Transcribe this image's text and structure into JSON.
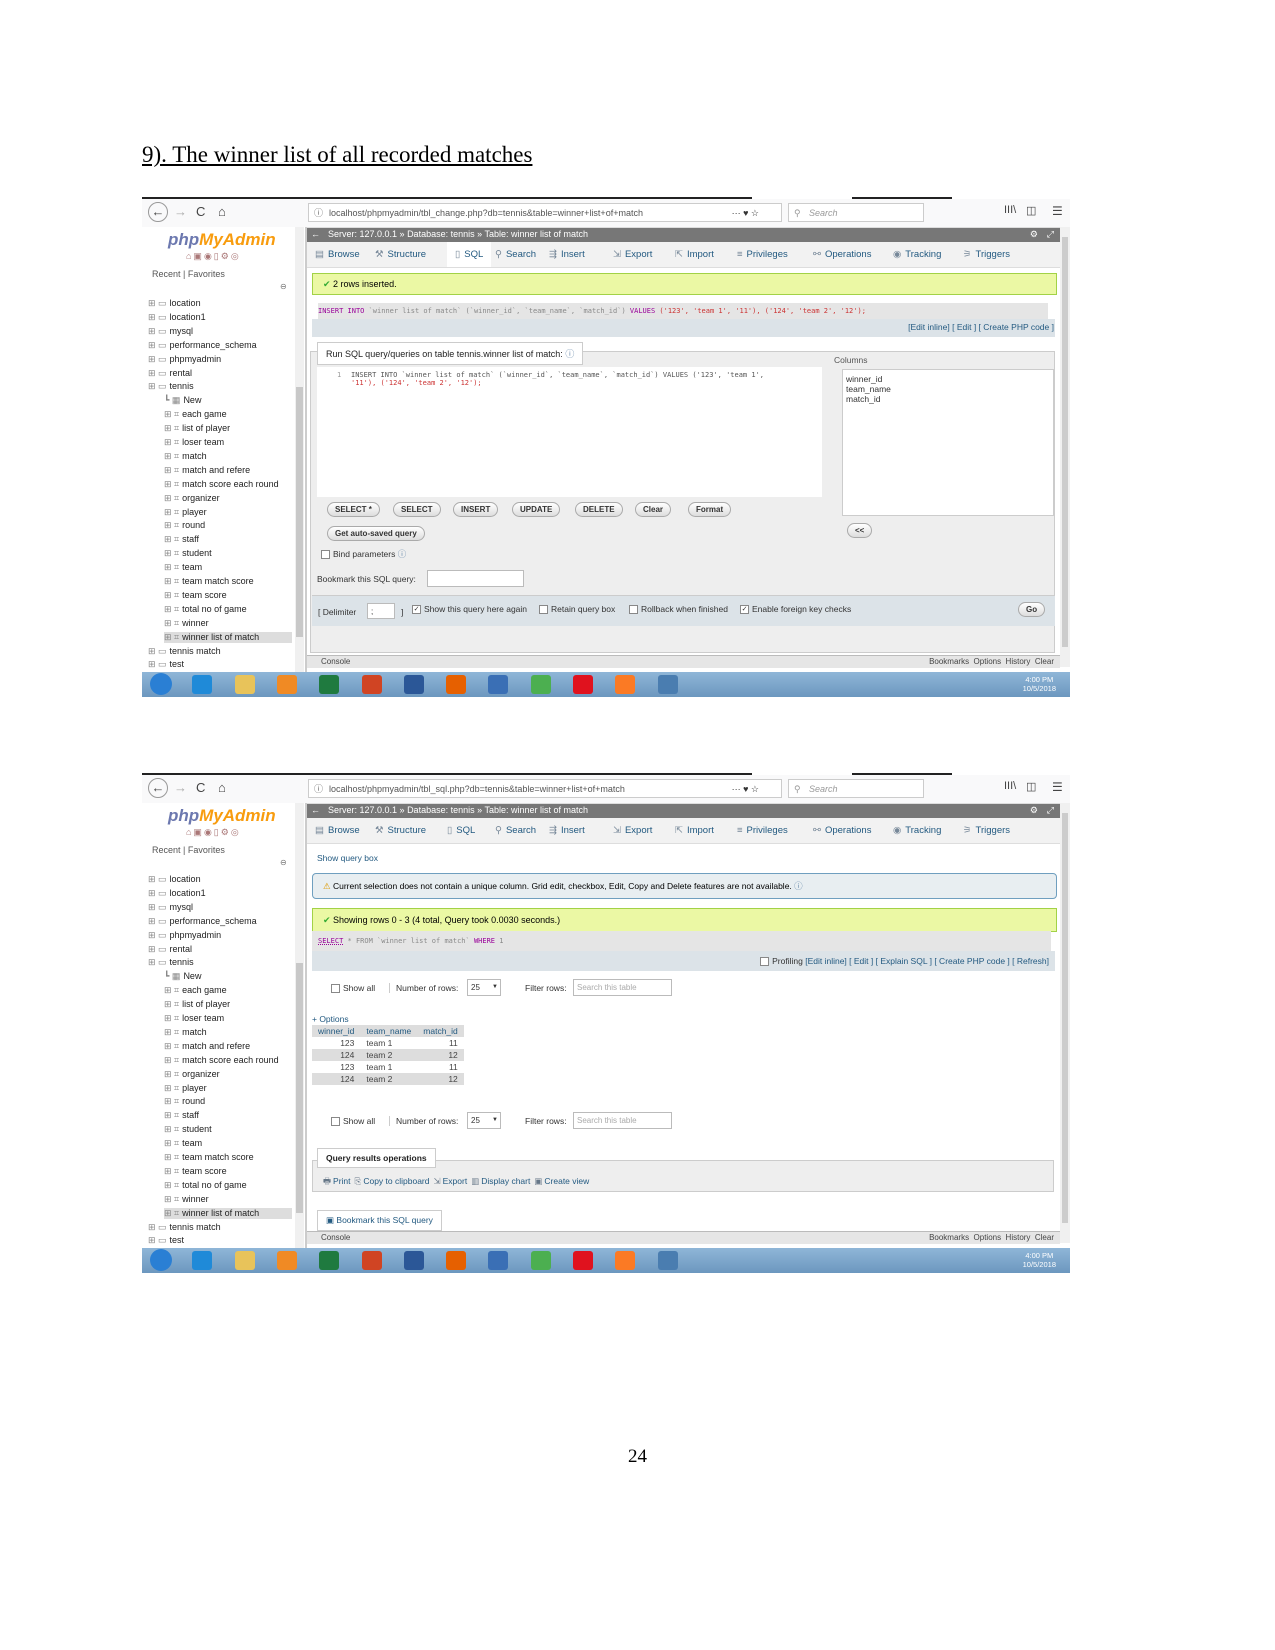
{
  "heading": "9). The winner list of all recorded matches",
  "page_number": "24",
  "browser": {
    "search_placeholder": "Search",
    "back": "←",
    "forward": "→",
    "reload": "C",
    "home": "⌂"
  },
  "app": {
    "logo_php": "php",
    "logo_my": "MyAdmin",
    "recent": "Recent",
    "favorites": "Favorites"
  },
  "sidebar": {
    "items": [
      "location",
      "location1",
      "mysql",
      "performance_schema",
      "phpmyadmin",
      "rental",
      "tennis",
      "New",
      "each game",
      "list of player",
      "loser team",
      "match",
      "match and refere",
      "match score each round",
      "organizer",
      "player",
      "round",
      "staff",
      "student",
      "team",
      "team match score",
      "team score",
      "total no of game",
      "winner",
      "winner list of match",
      "tennis match",
      "test"
    ],
    "selected": "winner list of match"
  },
  "breadcrumb": {
    "server": "Server: 127.0.0.1",
    "database": "Database: tennis",
    "table": "Table: winner list of match"
  },
  "tabs": [
    "Browse",
    "Structure",
    "SQL",
    "Search",
    "Insert",
    "Export",
    "Import",
    "Privileges",
    "Operations",
    "Tracking",
    "Triggers"
  ],
  "console": {
    "label": "Console",
    "right": "Bookmarks  Options  History  Clear"
  },
  "taskbar": {
    "time": "4:00 PM",
    "date": "10/5/2018",
    "apps": [
      "start",
      "ie",
      "explorer",
      "media",
      "excel",
      "powerpoint",
      "word",
      "firefox",
      "thunderbird",
      "chrome",
      "opera",
      "xampp",
      "screen"
    ],
    "colors": {
      "start": "#2a7fd4",
      "ie": "#1f8ad8",
      "explorer": "#e8c35a",
      "media": "#f08a24",
      "excel": "#1f7a3f",
      "powerpoint": "#d04423",
      "word": "#2b5797",
      "firefox": "#e66000",
      "thunderbird": "#3a6fb5",
      "chrome": "#4caf50",
      "opera": "#e0121e",
      "xampp": "#fb7a24",
      "screen": "#4a7db0"
    }
  },
  "shot1": {
    "url": "localhost/phpmyadmin/tbl_change.php?db=tennis&table=winner+list+of+match",
    "active_tab": "SQL",
    "message": "2 rows inserted.",
    "sql_parts": [
      "INSERT",
      "INTO",
      "`winner list of match` (`winner_id`, `team_name`, `match_id`)",
      "VALUES",
      "('123', 'team 1', '11'), ('124', 'team 2', '12');"
    ],
    "links": "[Edit inline] [ Edit ] [ Create PHP code ]",
    "query_legend": "Run SQL query/queries on table tennis.winner list of match:",
    "editor_line": "1",
    "editor_text_1": "INSERT INTO `winner list of match` (`winner_id`, `team_name`, `match_id`) VALUES ('123', 'team 1',",
    "editor_text_2": "'11'), ('124', 'team 2', '12');",
    "columns_label": "Columns",
    "columns": [
      "winner_id",
      "team_name",
      "match_id"
    ],
    "buttons": [
      "SELECT *",
      "SELECT",
      "INSERT",
      "UPDATE",
      "DELETE",
      "Clear",
      "Format"
    ],
    "autosaved": "Get auto-saved query",
    "insert_col": "<<",
    "bind": "Bind parameters",
    "bookmark": "Bookmark this SQL query:",
    "delimiter": "[ Delimiter",
    "delimiter_value": ";",
    "delimiter_close": "]",
    "opts": [
      {
        "label": "Show this query here again",
        "checked": true
      },
      {
        "label": "Retain query box",
        "checked": false
      },
      {
        "label": "Rollback when finished",
        "checked": false
      },
      {
        "label": "Enable foreign key checks",
        "checked": true
      }
    ],
    "go": "Go"
  },
  "shot2": {
    "url": "localhost/phpmyadmin/tbl_sql.php?db=tennis&table=winner+list+of+match",
    "active_tab": "Browse",
    "show_query_box": "Show query box",
    "warning": "Current selection does not contain a unique column. Grid edit, checkbox, Edit, Copy and Delete features are not available.",
    "message": "Showing rows 0 - 3 (4 total, Query took 0.0030 seconds.)",
    "sql_parts": [
      "SELECT",
      "* FROM `winner list of match`",
      "WHERE",
      "1"
    ],
    "profiling": "Profiling",
    "links": "[Edit inline] [ Edit ] [ Explain SQL ] [ Create PHP code ] [ Refresh]",
    "show_all": "Show all",
    "num_rows": "Number of rows:",
    "num_rows_value": "25",
    "filter": "Filter rows:",
    "filter_placeholder": "Search this table",
    "options": "+ Options",
    "headers": [
      "winner_id",
      "team_name",
      "match_id"
    ],
    "rows": [
      [
        "123",
        "team 1",
        "11"
      ],
      [
        "124",
        "team 2",
        "12"
      ],
      [
        "123",
        "team 1",
        "11"
      ],
      [
        "124",
        "team 2",
        "12"
      ]
    ],
    "ops_legend": "Query results operations",
    "ops": [
      "Print",
      "Copy to clipboard",
      "Export",
      "Display chart",
      "Create view"
    ],
    "bookmark_btn": "Bookmark this SQL query"
  }
}
